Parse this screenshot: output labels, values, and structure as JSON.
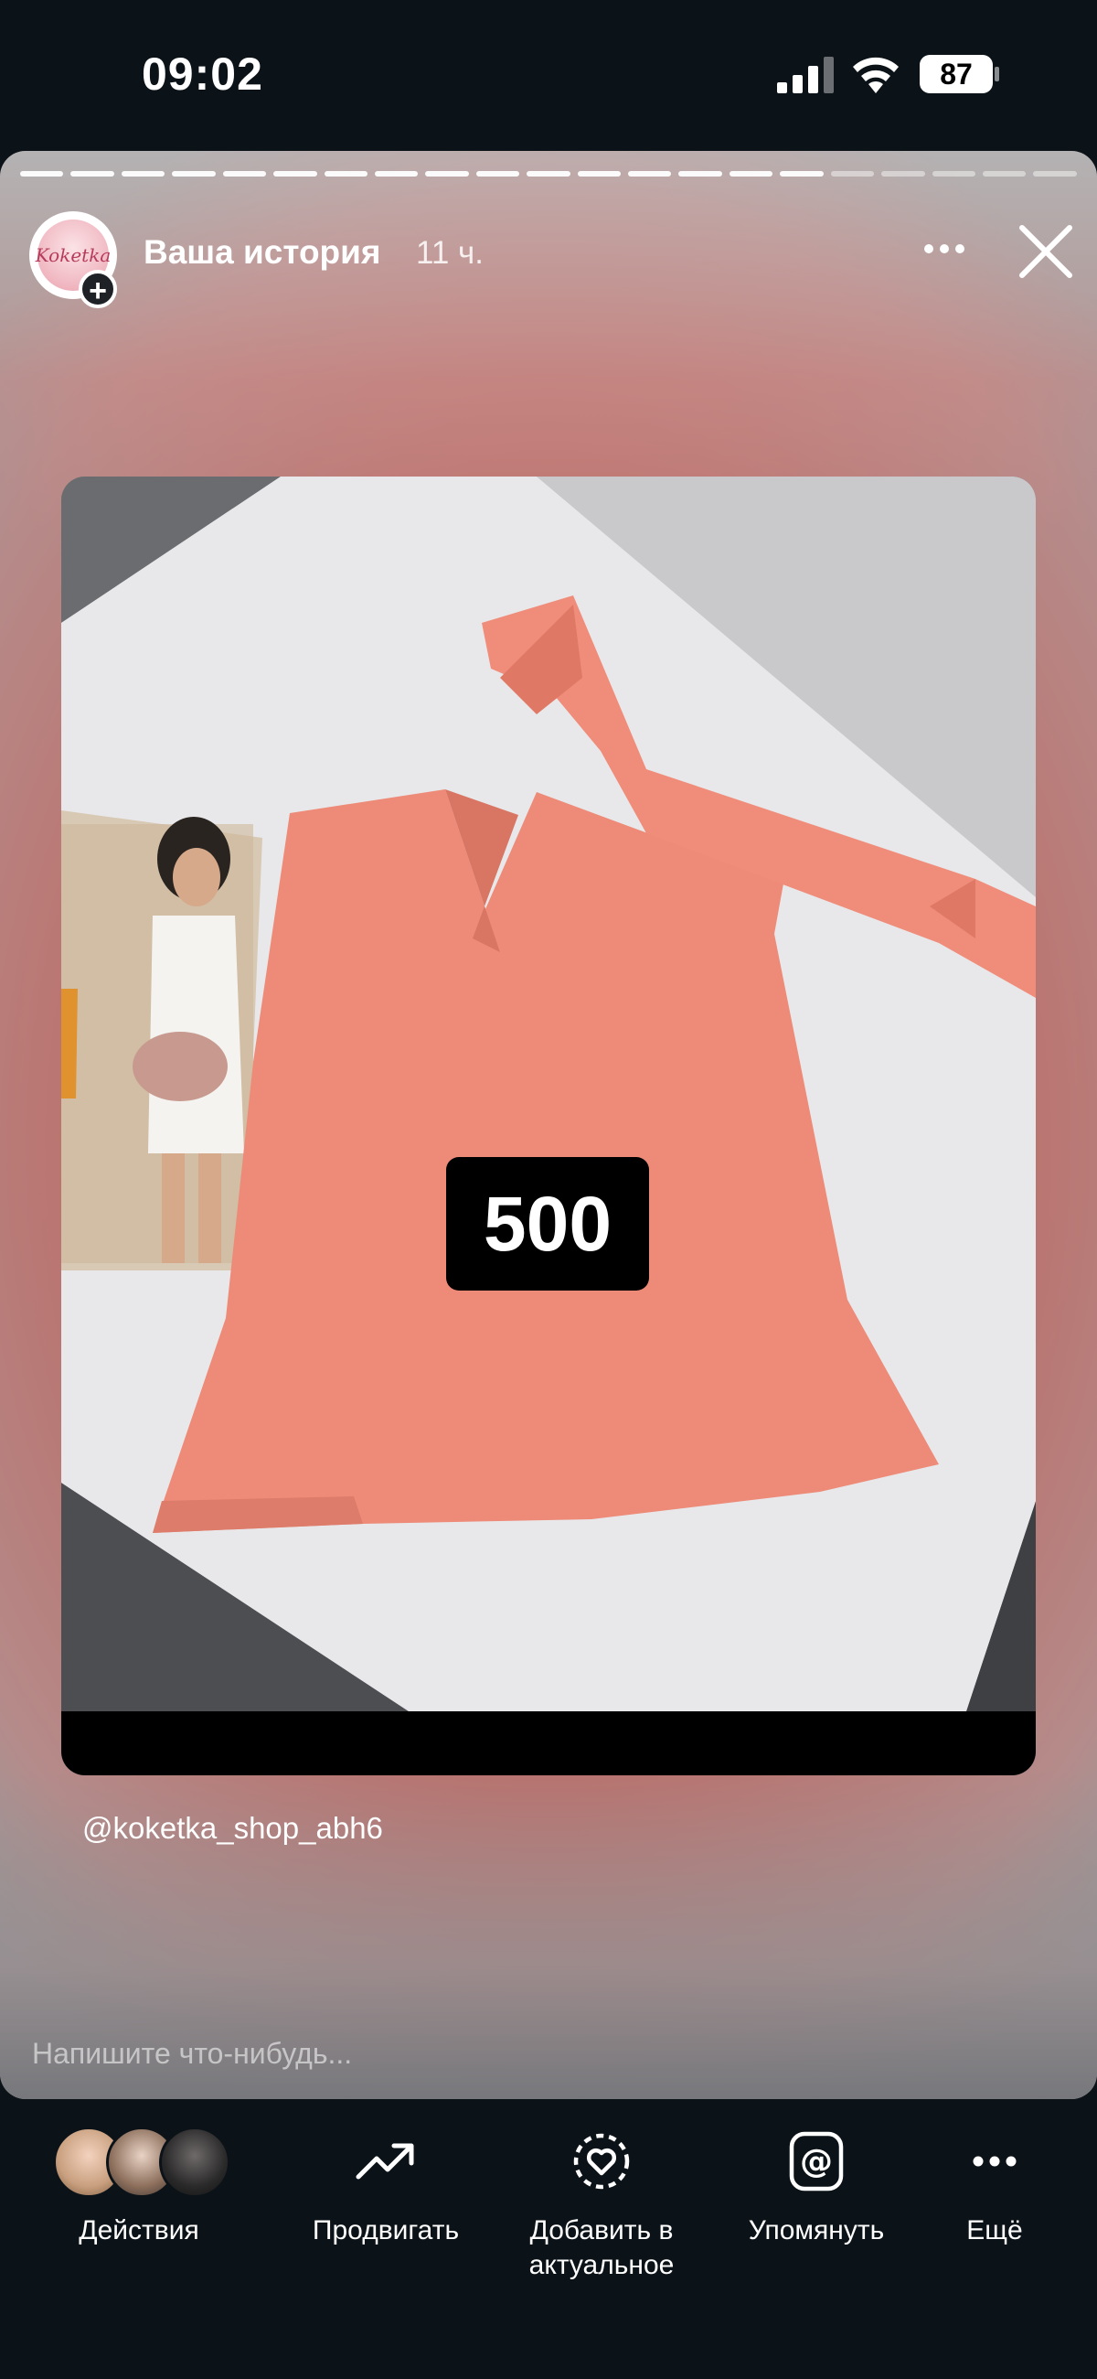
{
  "status_bar": {
    "time": "09:02",
    "battery": "87"
  },
  "story": {
    "progress_total": 21,
    "progress_done": 16,
    "title": "Ваша история",
    "age": "11 ч.",
    "avatar_text": "Koketka",
    "price": "500",
    "mention": "@koketka_shop_abh6",
    "reply_placeholder": "Напишите что-нибудь..."
  },
  "bottom_actions": [
    {
      "label": "Действия",
      "icon": "friends-avatars"
    },
    {
      "label": "Продвигать",
      "icon": "trending-up-icon"
    },
    {
      "label": "Добавить в актуальное",
      "icon": "highlight-heart-icon"
    },
    {
      "label": "Упомянуть",
      "icon": "mention-icon"
    },
    {
      "label": "Ещё",
      "icon": "more-icon"
    }
  ]
}
